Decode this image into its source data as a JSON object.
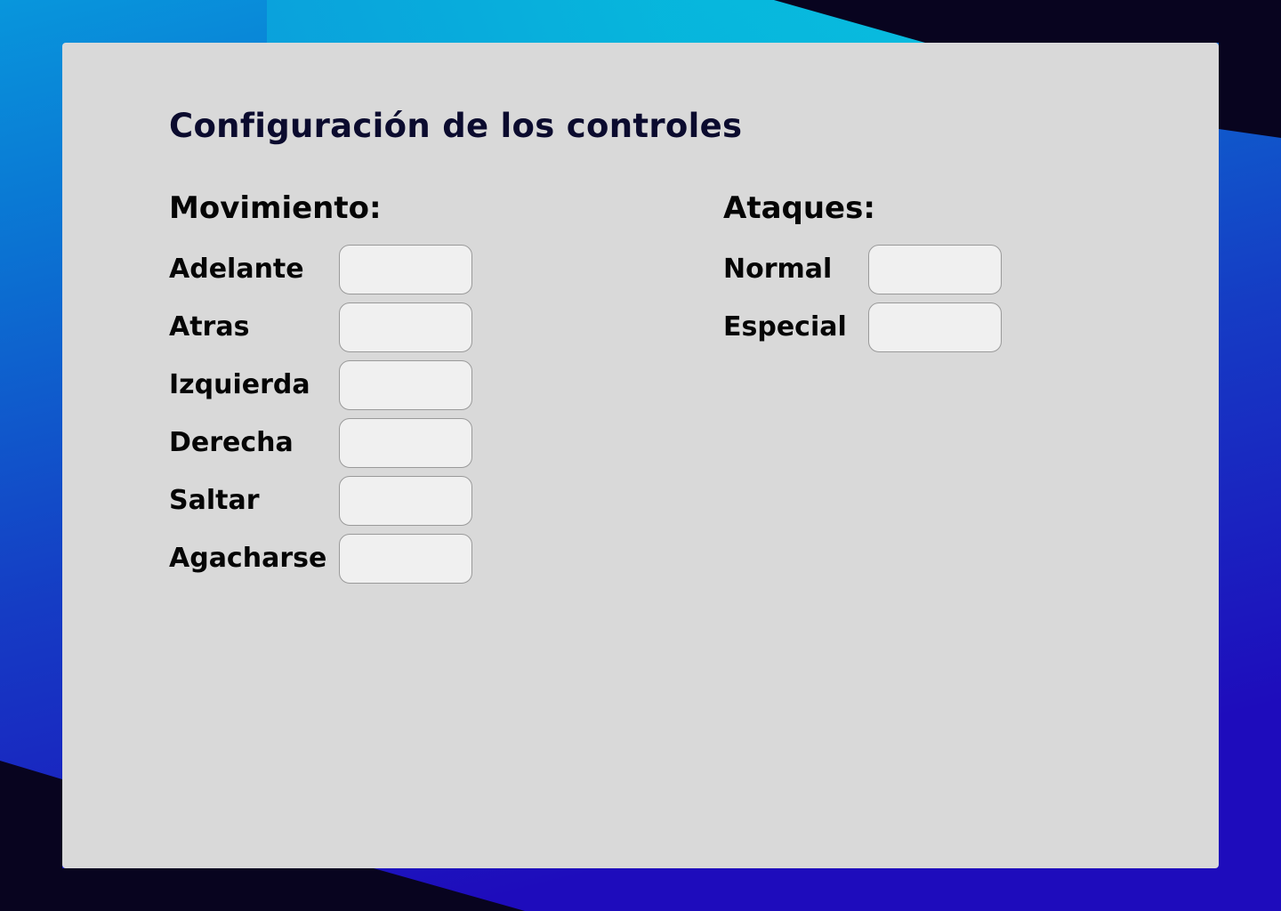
{
  "page": {
    "title": "Configuración de los controles"
  },
  "colors": {
    "panel_background": "#d9d9d9",
    "input_background": "#f0f0f0",
    "title_color": "#0b0b2e",
    "background_dark": "#08041f",
    "background_cyan": "#08bcdc",
    "background_blue": "#1e10c0"
  },
  "movement": {
    "heading": "Movimiento:",
    "items": [
      {
        "label": "Adelante",
        "value": "",
        "placeholder": ""
      },
      {
        "label": "Atras",
        "value": "",
        "placeholder": ""
      },
      {
        "label": "Izquierda",
        "value": "",
        "placeholder": ""
      },
      {
        "label": "Derecha",
        "value": "",
        "placeholder": ""
      },
      {
        "label": "Saltar",
        "value": "",
        "placeholder": ""
      },
      {
        "label": "Agacharse",
        "value": "",
        "placeholder": ""
      }
    ]
  },
  "attacks": {
    "heading": "Ataques:",
    "items": [
      {
        "label": "Normal",
        "value": "",
        "placeholder": ""
      },
      {
        "label": "Especial",
        "value": "",
        "placeholder": ""
      }
    ]
  }
}
